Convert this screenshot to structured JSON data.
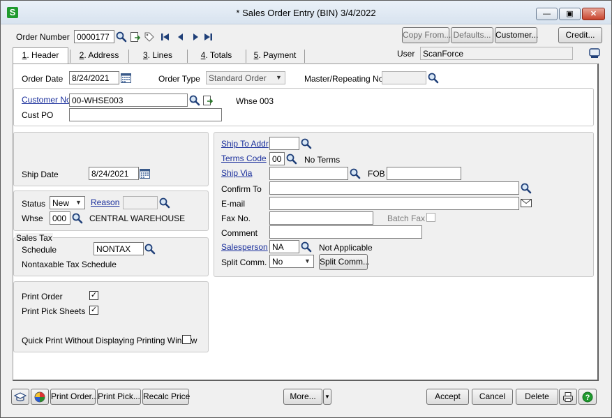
{
  "window": {
    "title": "* Sales Order Entry (BIN) 3/4/2022",
    "app_icon": "S"
  },
  "toolbar": {
    "order_number_label": "Order Number",
    "order_number_value": "0000177",
    "copy_from": "Copy From...",
    "defaults": "Defaults...",
    "customer": "Customer...",
    "credit": "Credit...",
    "user_label": "User",
    "user_value": "ScanForce"
  },
  "tabs": [
    {
      "num": "1",
      "label": ". Header",
      "active": true
    },
    {
      "num": "2",
      "label": ". Address"
    },
    {
      "num": "3",
      "label": ". Lines"
    },
    {
      "num": "4",
      "label": ". Totals"
    },
    {
      "num": "5",
      "label": ". Payment"
    }
  ],
  "header": {
    "order_date_label": "Order Date",
    "order_date_value": "8/24/2021",
    "order_type_label": "Order Type",
    "order_type_value": "Standard Order",
    "master_repeating_label": "Master/Repeating No.",
    "master_repeating_value": ""
  },
  "customer": {
    "customer_no_label": "Customer No.",
    "customer_no_value": "00-WHSE003",
    "customer_name": "Whse 003",
    "cust_po_label": "Cust PO",
    "cust_po_value": ""
  },
  "left": {
    "ship_date_label": "Ship Date",
    "ship_date_value": "8/24/2021",
    "status_label": "Status",
    "status_value": "New",
    "reason_label": "Reason",
    "reason_value": "",
    "whse_label": "Whse",
    "whse_value": "000",
    "whse_name": "CENTRAL WAREHOUSE",
    "sales_tax_label": "Sales Tax",
    "schedule_label": "Schedule",
    "schedule_value": "NONTAX",
    "schedule_desc": "Nontaxable Tax Schedule",
    "print_order_label": "Print Order",
    "print_order_checked": "✓",
    "print_pick_label": "Print Pick Sheets",
    "print_pick_checked": "✓",
    "quick_print_label": "Quick Print Without Displaying Printing Window"
  },
  "right": {
    "ship_to_addr_label": "Ship To Addr",
    "ship_to_addr_value": "",
    "terms_code_label": "Terms Code",
    "terms_code_value": "00",
    "terms_desc": "No Terms",
    "ship_via_label": "Ship Via",
    "ship_via_value": "",
    "fob_label": "FOB",
    "fob_value": "",
    "confirm_to_label": "Confirm To",
    "confirm_to_value": "",
    "email_label": "E-mail",
    "email_value": "",
    "fax_label": "Fax No.",
    "fax_value": "",
    "batch_fax_label": "Batch Fax",
    "comment_label": "Comment",
    "comment_value": "",
    "salesperson_label": "Salesperson",
    "salesperson_value": "NA",
    "salesperson_desc": "Not Applicable",
    "split_comm_label": "Split Comm.",
    "split_comm_value": "No",
    "split_comm_button": "Split Comm..."
  },
  "footer": {
    "print_order": "Print Order...",
    "print_pick": "Print Pick...",
    "recalc_price": "Recalc Price",
    "more": "More...",
    "accept": "Accept",
    "cancel": "Cancel",
    "delete": "Delete"
  },
  "icons": {
    "magnifier": "magnifier-icon",
    "calendar": "calendar-icon",
    "envelope": "envelope-icon",
    "printer": "printer-icon",
    "help": "help-icon"
  },
  "colors": {
    "link": "#1a2f9c",
    "app_icon_bg": "#1f9a2e",
    "close_button": "#c8442d"
  }
}
